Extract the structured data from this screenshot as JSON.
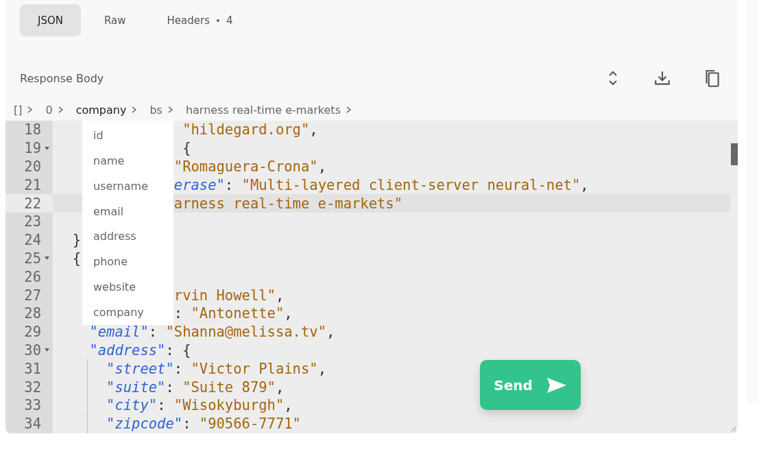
{
  "tabs": [
    {
      "label": "JSON",
      "selected": true
    },
    {
      "label": "Raw",
      "selected": false
    },
    {
      "label": "Headers",
      "count": "4",
      "selected": false
    }
  ],
  "response_body": {
    "title": "Response Body"
  },
  "breadcrumb": [
    {
      "label": "[]",
      "expanded": false
    },
    {
      "label": "0",
      "expanded": false
    },
    {
      "label": "company",
      "expanded": true
    },
    {
      "label": "bs",
      "expanded": false
    },
    {
      "label": "harness real-time e-markets",
      "expanded": false
    }
  ],
  "path_menu": {
    "items": [
      {
        "label": "id"
      },
      {
        "label": "name"
      },
      {
        "label": "username"
      },
      {
        "label": "email"
      },
      {
        "label": "address"
      },
      {
        "label": "phone"
      },
      {
        "label": "website"
      },
      {
        "label": "company"
      }
    ]
  },
  "editor": {
    "lines": [
      {
        "number": "18",
        "fold": false,
        "active": false,
        "guide": false,
        "tokens": [
          {
            "kind": "string",
            "text": "               \"hildegard.org\""
          },
          {
            "kind": "punct",
            "text": ","
          }
        ]
      },
      {
        "number": "19",
        "fold": true,
        "active": false,
        "guide": false,
        "tokens": [
          {
            "kind": "punct",
            "text": "               {"
          }
        ]
      },
      {
        "number": "20",
        "fold": false,
        "active": false,
        "guide": false,
        "tokens": [
          {
            "kind": "string",
            "text": "              \"Romaguera-Crona\""
          },
          {
            "kind": "punct",
            "text": ","
          }
        ]
      },
      {
        "number": "21",
        "fold": false,
        "active": false,
        "guide": false,
        "tokens": [
          {
            "kind": "key",
            "text": "              erase\""
          },
          {
            "kind": "punct",
            "text": ": "
          },
          {
            "kind": "string",
            "text": "\"Multi-layered client-server neural-net\""
          },
          {
            "kind": "punct",
            "text": ","
          }
        ]
      },
      {
        "number": "22",
        "fold": false,
        "active": true,
        "guide": false,
        "tokens": [
          {
            "kind": "string",
            "text": "              arness real-time e-markets\""
          }
        ]
      },
      {
        "number": "23",
        "fold": false,
        "active": false,
        "guide": false
      },
      {
        "number": "24",
        "fold": false,
        "active": false,
        "guide": false,
        "tokens": [
          {
            "kind": "punct",
            "text": "  }"
          }
        ]
      },
      {
        "number": "25",
        "fold": true,
        "active": false,
        "guide": false,
        "tokens": [
          {
            "kind": "punct",
            "text": "  {"
          }
        ]
      },
      {
        "number": "26",
        "fold": false,
        "active": false,
        "guide": false
      },
      {
        "number": "27",
        "fold": false,
        "active": false,
        "guide": false,
        "tokens": [
          {
            "kind": "string",
            "text": "              rvin Howell\""
          },
          {
            "kind": "punct",
            "text": ","
          }
        ]
      },
      {
        "number": "28",
        "fold": false,
        "active": false,
        "guide": false,
        "tokens": [
          {
            "kind": "punct",
            "text": "              : "
          },
          {
            "kind": "string",
            "text": "\"Antonette\""
          },
          {
            "kind": "punct",
            "text": ","
          }
        ]
      },
      {
        "number": "29",
        "fold": false,
        "active": false,
        "guide": false,
        "tokens": [
          {
            "kind": "key",
            "text": "    \"email\""
          },
          {
            "kind": "punct",
            "text": ": "
          },
          {
            "kind": "string",
            "text": "\"Shanna@melissa.tv\""
          },
          {
            "kind": "punct",
            "text": ","
          }
        ]
      },
      {
        "number": "30",
        "fold": true,
        "active": false,
        "guide": false,
        "tokens": [
          {
            "kind": "key",
            "text": "    \"address\""
          },
          {
            "kind": "punct",
            "text": ": {"
          }
        ]
      },
      {
        "number": "31",
        "fold": false,
        "active": false,
        "guide": true,
        "tokens": [
          {
            "kind": "key",
            "text": "      \"street\""
          },
          {
            "kind": "punct",
            "text": ": "
          },
          {
            "kind": "string",
            "text": "\"Victor Plains\""
          },
          {
            "kind": "punct",
            "text": ","
          }
        ]
      },
      {
        "number": "32",
        "fold": false,
        "active": false,
        "guide": true,
        "tokens": [
          {
            "kind": "key",
            "text": "      \"suite\""
          },
          {
            "kind": "punct",
            "text": ": "
          },
          {
            "kind": "string",
            "text": "\"Suite 879\""
          },
          {
            "kind": "punct",
            "text": ","
          }
        ]
      },
      {
        "number": "33",
        "fold": false,
        "active": false,
        "guide": true,
        "tokens": [
          {
            "kind": "key",
            "text": "      \"city\""
          },
          {
            "kind": "punct",
            "text": ": "
          },
          {
            "kind": "string",
            "text": "\"Wisokyburgh\""
          },
          {
            "kind": "punct",
            "text": ","
          }
        ]
      },
      {
        "number": "34",
        "fold": false,
        "active": false,
        "guide": true,
        "tokens": [
          {
            "kind": "key",
            "text": "      \"zipcode\""
          },
          {
            "kind": "punct",
            "text": ": "
          },
          {
            "kind": "string",
            "text": "\"90566-7771\""
          }
        ]
      }
    ]
  },
  "send_button": {
    "label": "Send"
  }
}
